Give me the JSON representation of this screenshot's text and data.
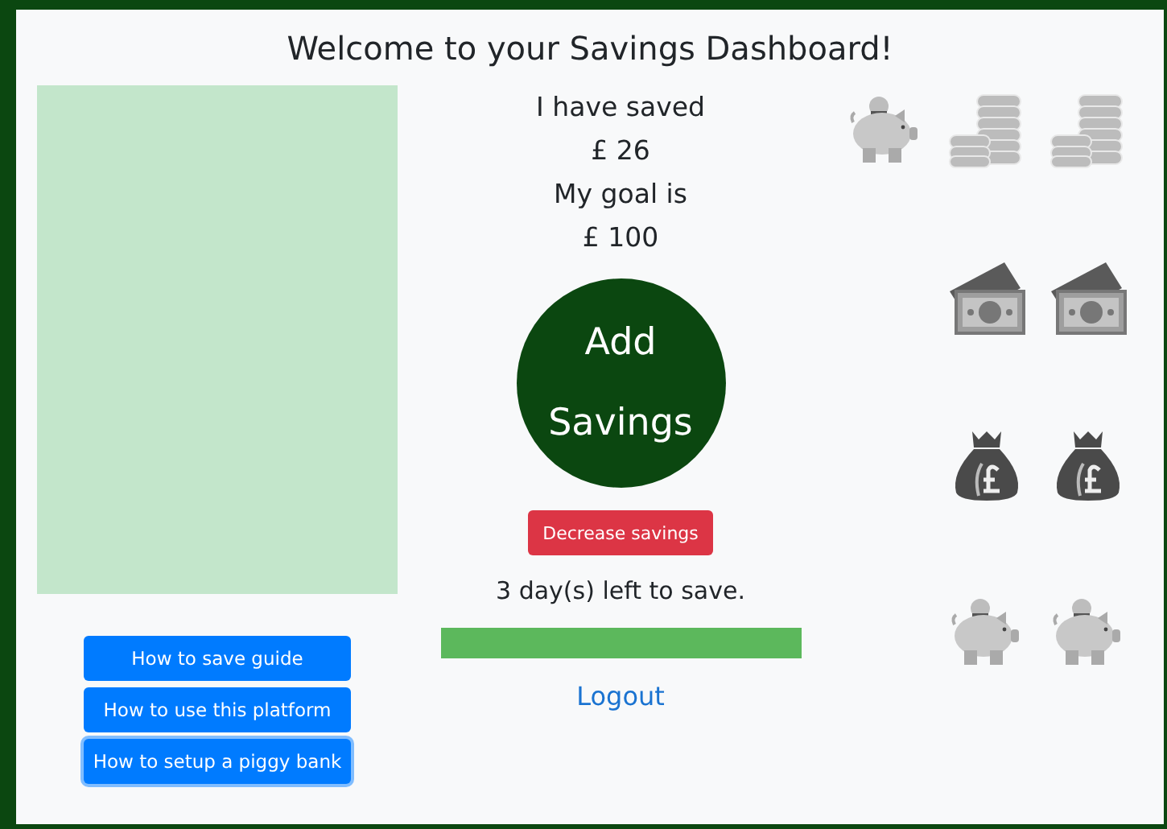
{
  "title": "Welcome to your Savings Dashboard!",
  "summary": [
    {
      "text": "I have saved"
    },
    {
      "text": "£ 26"
    },
    {
      "text": "My goal is"
    },
    {
      "text": "£ 100"
    }
  ],
  "add_button": "Add Savings",
  "decrease_button": "Decrease savings",
  "days_left": "3 day(s) left to save.",
  "progress": {
    "level": 1
  },
  "logout": "Logout",
  "guide_buttons": [
    {
      "label": "How to save guide",
      "focused": false
    },
    {
      "label": "How to use this platform",
      "focused": false
    },
    {
      "label": "How to setup a piggy bank",
      "focused": true
    }
  ]
}
